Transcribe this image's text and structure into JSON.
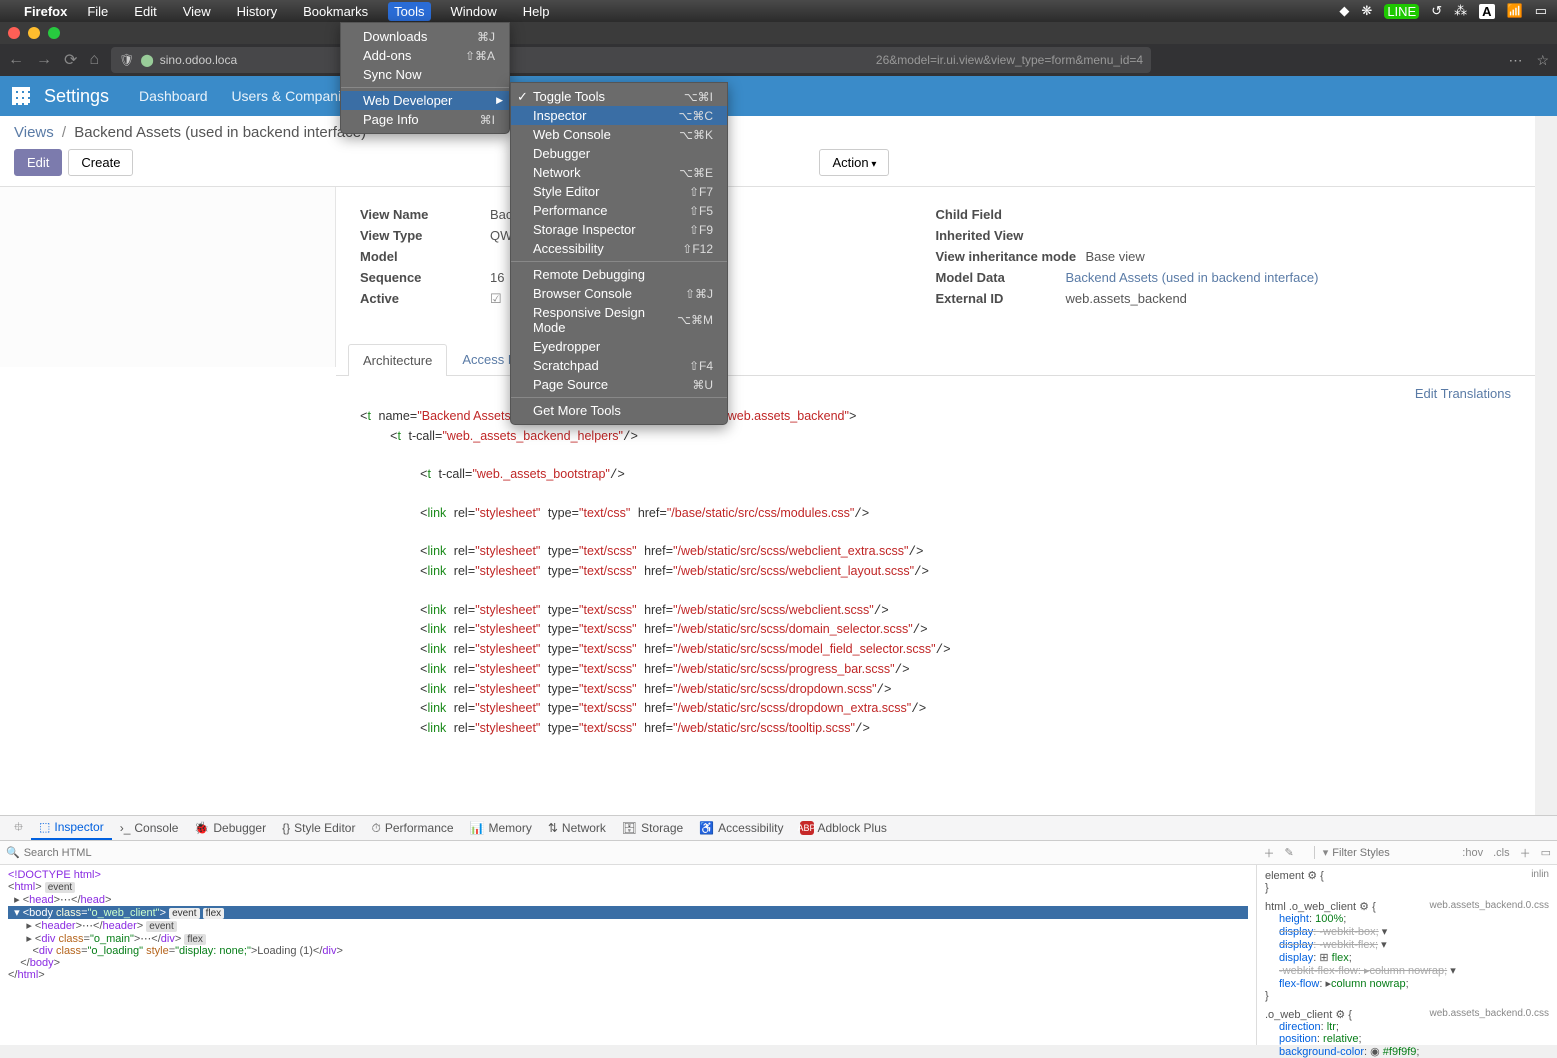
{
  "mac": {
    "appname": "Firefox",
    "menus": [
      "File",
      "Edit",
      "View",
      "History",
      "Bookmarks",
      "Tools",
      "Window",
      "Help"
    ],
    "active_menu": "Tools"
  },
  "url": {
    "host": "sino.odoo.loca",
    "query": "26&model=ir.ui.view&view_type=form&menu_id=4"
  },
  "odoo": {
    "title": "Settings",
    "nav": [
      "Dashboard",
      "Users & Companies"
    ]
  },
  "breadcrumb": {
    "root": "Views",
    "current": "Backend Assets (used in backend interface)"
  },
  "buttons": {
    "edit": "Edit",
    "create": "Create",
    "action": "Action"
  },
  "form": {
    "left": {
      "view_name_lbl": "View Name",
      "view_name": "Back",
      "view_type_lbl": "View Type",
      "view_type": "QWe",
      "model_lbl": "Model",
      "sequence_lbl": "Sequence",
      "sequence": "16",
      "active_lbl": "Active"
    },
    "right": {
      "child_lbl": "Child Field",
      "inh_lbl": "Inherited View",
      "mode_lbl": "View inheritance mode",
      "mode_val": "Base view",
      "md_lbl": "Model Data",
      "md_val": "Backend Assets (used in backend interface)",
      "ext_lbl": "External ID",
      "ext_val": "web.assets_backend"
    }
  },
  "tabs": {
    "arch": "Architecture",
    "access": "Access Rig"
  },
  "edit_trans": "Edit Translations",
  "tools_menu": [
    {
      "l": "Downloads",
      "s": "⌘J"
    },
    {
      "l": "Add-ons",
      "s": "⇧⌘A"
    },
    {
      "l": "Sync Now",
      "s": ""
    },
    {
      "sep": true
    },
    {
      "l": "Web Developer",
      "sub": true,
      "hl": true
    },
    {
      "l": "Page Info",
      "s": "⌘I"
    }
  ],
  "webdev_menu": [
    {
      "l": "Toggle Tools",
      "s": "⌥⌘I",
      "chk": true
    },
    {
      "l": "Inspector",
      "s": "⌥⌘C",
      "hl": true
    },
    {
      "l": "Web Console",
      "s": "⌥⌘K"
    },
    {
      "l": "Debugger"
    },
    {
      "l": "Network",
      "s": "⌥⌘E"
    },
    {
      "l": "Style Editor",
      "s": "⇧F7"
    },
    {
      "l": "Performance",
      "s": "⇧F5"
    },
    {
      "l": "Storage Inspector",
      "s": "⇧F9"
    },
    {
      "l": "Accessibility",
      "s": "⇧F12"
    },
    {
      "sep": true
    },
    {
      "l": "Remote Debugging"
    },
    {
      "l": "Browser Console",
      "s": "⇧⌘J"
    },
    {
      "l": "Responsive Design Mode",
      "s": "⌥⌘M"
    },
    {
      "l": "Eyedropper"
    },
    {
      "l": "Scratchpad",
      "s": "⇧F4"
    },
    {
      "l": "Page Source",
      "s": "⌘U"
    },
    {
      "sep": true
    },
    {
      "l": "Get More Tools"
    }
  ],
  "devtools": {
    "tabs": [
      "Inspector",
      "Console",
      "Debugger",
      "Style Editor",
      "Performance",
      "Memory",
      "Network",
      "Storage",
      "Accessibility",
      "Adblock Plus"
    ],
    "search_ph": "Search HTML",
    "filter_ph": "Filter Styles",
    "hov": ":hov",
    "cls": ".cls"
  },
  "css": {
    "file": "web.assets_backend.0.css",
    "sel1": "html .o_web_client",
    "height": "100%",
    "disp_wk": "-webkit-box",
    "disp_wf": "-webkit-flex",
    "disp": "flex",
    "ff_wk": "column nowrap",
    "ff": "column nowrap",
    "sel2": ".o_web_client",
    "dir": "ltr",
    "pos": "relative",
    "bg": "#f9f9f9"
  }
}
